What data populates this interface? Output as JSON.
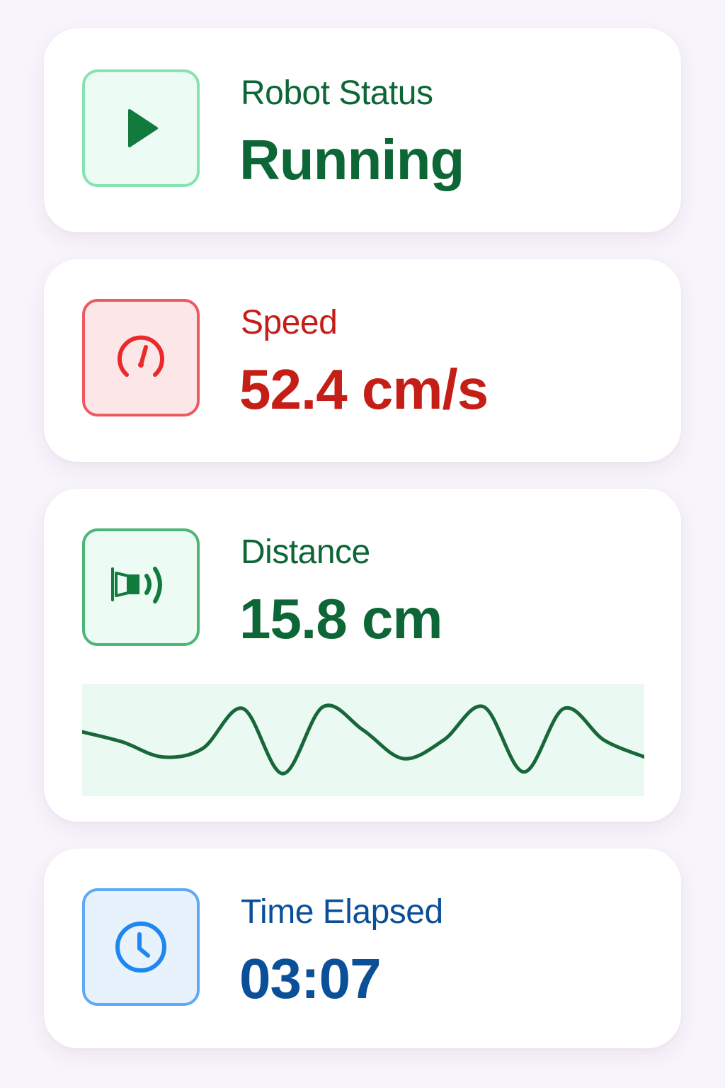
{
  "cards": [
    {
      "label": "Robot Status",
      "value": "Running",
      "icon": "play-icon",
      "colors": {
        "text": "#0d6636",
        "icon": "#137a3e",
        "border": "#86e3b1",
        "fill": "#ecfbf3"
      }
    },
    {
      "label": "Speed",
      "value": "52.4 cm/s",
      "icon": "speedometer-icon",
      "colors": {
        "text": "#c41e16",
        "icon": "#ea2a2a",
        "border": "#ec5a60",
        "fill": "#fde6e8"
      }
    },
    {
      "label": "Distance",
      "value": "15.8 cm",
      "icon": "ultrasonic-sensor-icon",
      "colors": {
        "text": "#0d6636",
        "icon": "#137a3e",
        "border": "#4bb676",
        "fill": "#ecfbf3"
      },
      "chart": {
        "fill": "#eaf9f1",
        "line": "#17673a",
        "values": [
          0.6,
          0.48,
          0.3,
          0.4,
          0.88,
          0.1,
          0.9,
          0.62,
          0.28,
          0.5,
          0.9,
          0.12,
          0.88,
          0.5,
          0.3
        ]
      }
    },
    {
      "label": "Time Elapsed",
      "value": "03:07",
      "icon": "clock-icon",
      "colors": {
        "text": "#0c4f99",
        "icon": "#1e88f0",
        "border": "#5fa8f5",
        "fill": "#e8f2fd"
      }
    }
  ]
}
